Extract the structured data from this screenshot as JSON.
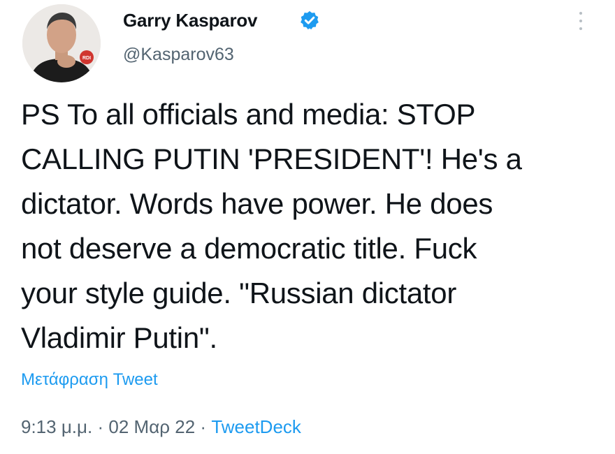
{
  "tweet": {
    "author": {
      "display_name": "Garry Kasparov",
      "handle": "@Kasparov63",
      "verified_icon": "verified-badge-icon",
      "avatar_badge_text": "RDI"
    },
    "text": "PS To all officials and media: STOP\nCALLING PUTIN 'PRESIDENT'! He's a\ndictator. Words have power. He does\nnot deserve a democratic title. Fuck\nyour style guide. \"Russian dictator\nVladimir Putin\".",
    "translate_label": "Μετάφραση Tweet",
    "time": "9:13 μ.μ.",
    "separator": "·",
    "date": "02 Μαρ 22",
    "source": "TweetDeck",
    "more_icon": "more-options-icon"
  },
  "colors": {
    "text": "#0f1419",
    "secondary": "#536471",
    "link": "#1d9bf0",
    "verified": "#1d9bf0"
  }
}
